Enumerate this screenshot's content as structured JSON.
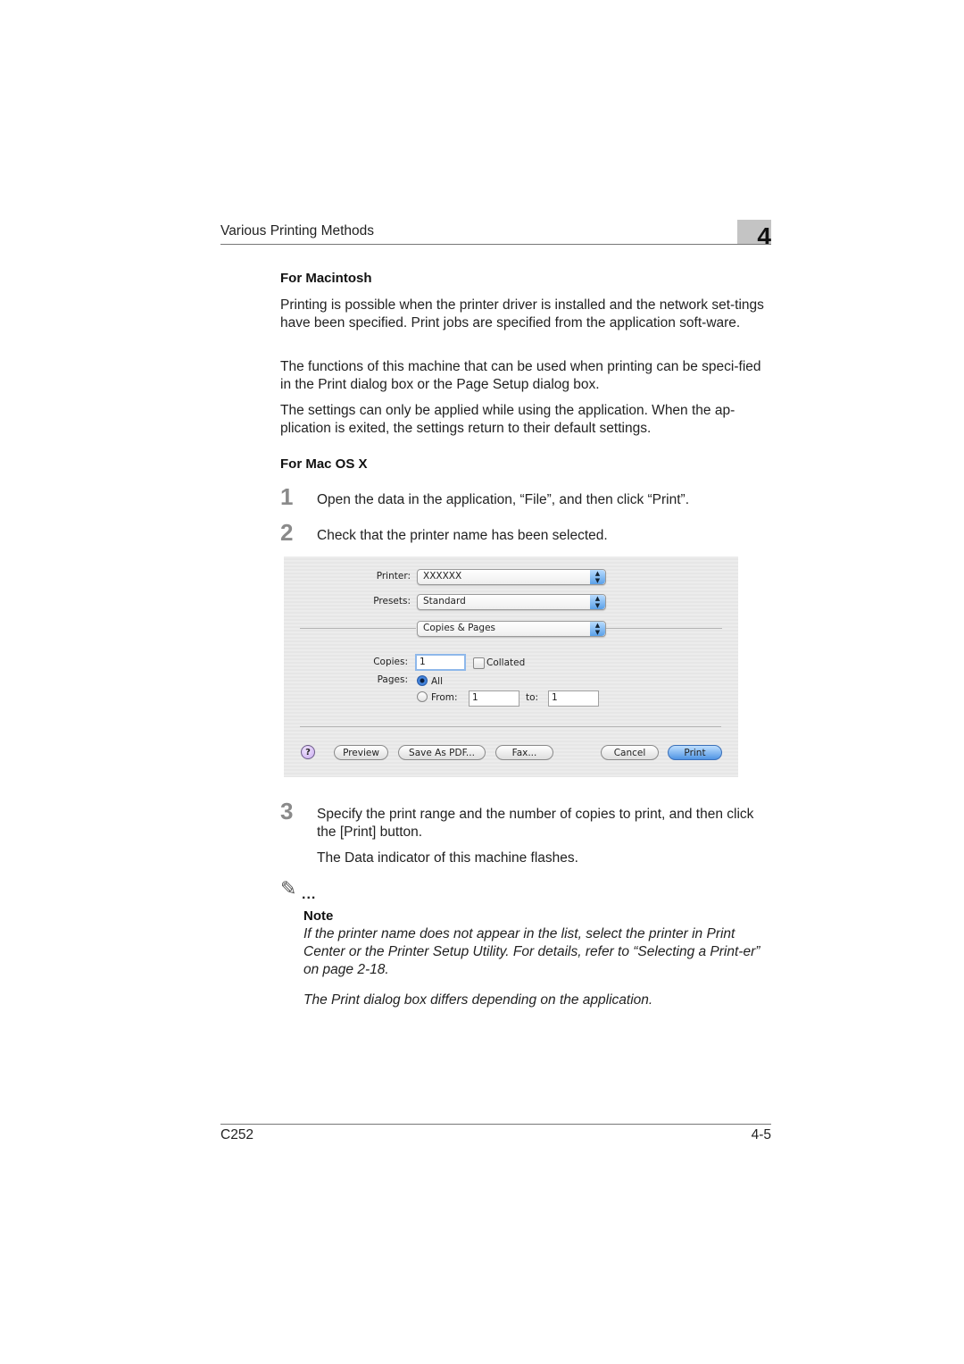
{
  "header": {
    "title": "Various Printing Methods",
    "chapter": "4"
  },
  "section": {
    "heading": "For Macintosh",
    "paragraphs": [
      "Printing is possible when the printer driver is installed and the network set-tings have been specified. Print jobs are specified from the application soft-ware.",
      "The functions of this machine that can be used when printing can be speci-fied in the Print dialog box or the Page Setup dialog box.",
      "The settings can only be applied while using the application. When the ap-plication is exited, the settings return to their default settings."
    ]
  },
  "subsection": {
    "heading": "For Mac OS X",
    "steps": [
      {
        "num": "1",
        "text": "Open the data in the application, “File”, and then click “Print”."
      },
      {
        "num": "2",
        "text": "Check that the printer name has been selected."
      },
      {
        "num": "3",
        "text": "Specify the print range and the number of copies to print, and then click the [Print] button.",
        "result": "The Data indicator of this machine flashes."
      }
    ]
  },
  "dialog": {
    "printer_label": "Printer:",
    "printer_value": "XXXXXX",
    "presets_label": "Presets:",
    "presets_value": "Standard",
    "panel_value": "Copies & Pages",
    "copies_label": "Copies:",
    "copies_value": "1",
    "collated_label": "Collated",
    "collated_checked": false,
    "pages_label": "Pages:",
    "pages_all_label": "All",
    "pages_from_label": "From:",
    "pages_from_value": "1",
    "pages_to_label": "to:",
    "pages_to_value": "1",
    "pages_selected": "All",
    "help_label": "?",
    "buttons": {
      "preview": "Preview",
      "save_pdf": "Save As PDF...",
      "fax": "Fax...",
      "cancel": "Cancel",
      "print": "Print"
    }
  },
  "note": {
    "icon": "pencil-note-icon",
    "dots": "...",
    "label": "Note",
    "paragraphs": [
      "If the printer name does not appear in the list, select the printer in Print Center or the Printer Setup Utility. For details, refer to “Selecting a Print-er” on page 2-18.",
      "The Print dialog box differs depending on the application."
    ]
  },
  "footer": {
    "model": "C252",
    "page": "4-5"
  }
}
